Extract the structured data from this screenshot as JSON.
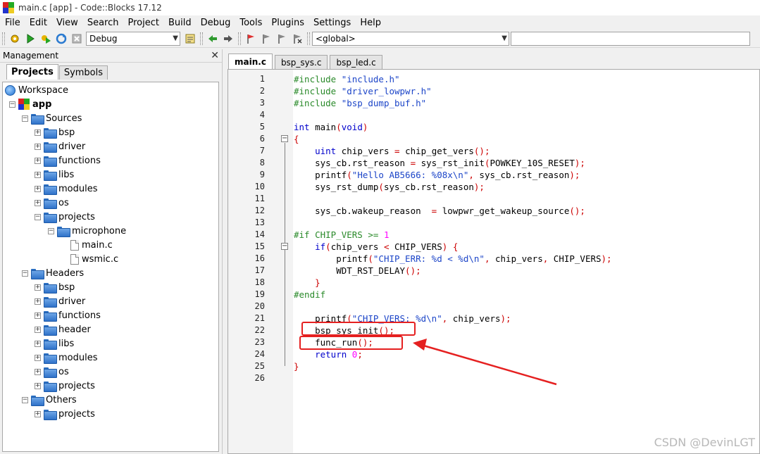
{
  "window": {
    "title": "main.c [app] - Code::Blocks 17.12"
  },
  "menu": [
    "File",
    "Edit",
    "View",
    "Search",
    "Project",
    "Build",
    "Debug",
    "Tools",
    "Plugins",
    "Settings",
    "Help"
  ],
  "toolbar": {
    "build_target": "Debug",
    "scope": "<global>",
    "function": ""
  },
  "management": {
    "title": "Management",
    "close": "✕",
    "tabs": [
      "Projects",
      "Symbols"
    ],
    "tree": [
      {
        "label": "Workspace",
        "level": 0,
        "kind": "workspace"
      },
      {
        "label": "app",
        "level": 1,
        "kind": "project",
        "expander": "−"
      },
      {
        "label": "Sources",
        "level": 2,
        "kind": "folder",
        "expander": "−"
      },
      {
        "label": "bsp",
        "level": 3,
        "kind": "folder",
        "expander": "+"
      },
      {
        "label": "driver",
        "level": 3,
        "kind": "folder",
        "expander": "+"
      },
      {
        "label": "functions",
        "level": 3,
        "kind": "folder",
        "expander": "+"
      },
      {
        "label": "libs",
        "level": 3,
        "kind": "folder",
        "expander": "+"
      },
      {
        "label": "modules",
        "level": 3,
        "kind": "folder",
        "expander": "+"
      },
      {
        "label": "os",
        "level": 3,
        "kind": "folder",
        "expander": "+"
      },
      {
        "label": "projects",
        "level": 3,
        "kind": "folder",
        "expander": "−"
      },
      {
        "label": "microphone",
        "level": 4,
        "kind": "folder",
        "expander": "−"
      },
      {
        "label": "main.c",
        "level": 5,
        "kind": "file"
      },
      {
        "label": "wsmic.c",
        "level": 5,
        "kind": "file"
      },
      {
        "label": "Headers",
        "level": 2,
        "kind": "folder",
        "expander": "−"
      },
      {
        "label": "bsp",
        "level": 3,
        "kind": "folder",
        "expander": "+"
      },
      {
        "label": "driver",
        "level": 3,
        "kind": "folder",
        "expander": "+"
      },
      {
        "label": "functions",
        "level": 3,
        "kind": "folder",
        "expander": "+"
      },
      {
        "label": "header",
        "level": 3,
        "kind": "folder",
        "expander": "+"
      },
      {
        "label": "libs",
        "level": 3,
        "kind": "folder",
        "expander": "+"
      },
      {
        "label": "modules",
        "level": 3,
        "kind": "folder",
        "expander": "+"
      },
      {
        "label": "os",
        "level": 3,
        "kind": "folder",
        "expander": "+"
      },
      {
        "label": "projects",
        "level": 3,
        "kind": "folder",
        "expander": "+"
      },
      {
        "label": "Others",
        "level": 2,
        "kind": "folder",
        "expander": "−"
      },
      {
        "label": "projects",
        "level": 3,
        "kind": "folder",
        "expander": "+"
      }
    ]
  },
  "editor": {
    "tabs": [
      "main.c",
      "bsp_sys.c",
      "bsp_led.c"
    ],
    "active_tab": 0,
    "lines": [
      [
        [
          "pp",
          "#include "
        ],
        [
          "str",
          "\"include.h\""
        ]
      ],
      [
        [
          "pp",
          "#include "
        ],
        [
          "str",
          "\"driver_lowpwr.h\""
        ]
      ],
      [
        [
          "pp",
          "#include "
        ],
        [
          "str",
          "\"bsp_dump_buf.h\""
        ]
      ],
      [],
      [
        [
          "kw",
          "int"
        ],
        [
          "",
          " main"
        ],
        [
          "op",
          "("
        ],
        [
          "kw",
          "void"
        ],
        [
          "op",
          ")"
        ]
      ],
      [
        [
          "op",
          "{"
        ]
      ],
      [
        [
          "",
          "    "
        ],
        [
          "kw",
          "uint"
        ],
        [
          "",
          " chip_vers "
        ],
        [
          "op",
          "="
        ],
        [
          "",
          " chip_get_vers"
        ],
        [
          "op",
          "();"
        ]
      ],
      [
        [
          "",
          "    sys_cb.rst_reason "
        ],
        [
          "op",
          "="
        ],
        [
          "",
          " sys_rst_init"
        ],
        [
          "op",
          "("
        ],
        [
          "",
          "POWKEY_10S_RESET"
        ],
        [
          "op",
          ");"
        ]
      ],
      [
        [
          "",
          "    printf"
        ],
        [
          "op",
          "("
        ],
        [
          "str",
          "\"Hello AB5666: %08x\\n\""
        ],
        [
          "op",
          ","
        ],
        [
          "",
          " sys_cb.rst_reason"
        ],
        [
          "op",
          ");"
        ]
      ],
      [
        [
          "",
          "    sys_rst_dump"
        ],
        [
          "op",
          "("
        ],
        [
          "",
          "sys_cb.rst_reason"
        ],
        [
          "op",
          ");"
        ]
      ],
      [],
      [
        [
          "",
          "    sys_cb.wakeup_reason  "
        ],
        [
          "op",
          "="
        ],
        [
          "",
          " lowpwr_get_wakeup_source"
        ],
        [
          "op",
          "();"
        ]
      ],
      [],
      [
        [
          "pp",
          "#if CHIP_VERS >= "
        ],
        [
          "num",
          "1"
        ]
      ],
      [
        [
          "",
          "    "
        ],
        [
          "kw",
          "if"
        ],
        [
          "op",
          "("
        ],
        [
          "",
          "chip_vers "
        ],
        [
          "op",
          "<"
        ],
        [
          "",
          " CHIP_VERS"
        ],
        [
          "op",
          ")"
        ],
        [
          "",
          " "
        ],
        [
          "op",
          "{"
        ]
      ],
      [
        [
          "",
          "        printf"
        ],
        [
          "op",
          "("
        ],
        [
          "str",
          "\"CHIP_ERR: %d < %d\\n\""
        ],
        [
          "op",
          ","
        ],
        [
          "",
          " chip_vers"
        ],
        [
          "op",
          ","
        ],
        [
          "",
          " CHIP_VERS"
        ],
        [
          "op",
          ");"
        ]
      ],
      [
        [
          "",
          "        WDT_RST_DELAY"
        ],
        [
          "op",
          "();"
        ]
      ],
      [
        [
          "",
          "    "
        ],
        [
          "op",
          "}"
        ]
      ],
      [
        [
          "pp",
          "#endif"
        ]
      ],
      [],
      [
        [
          "",
          "    printf"
        ],
        [
          "op",
          "("
        ],
        [
          "str",
          "\"CHIP_VERS: %d\\n\""
        ],
        [
          "op",
          ","
        ],
        [
          "",
          " chip_vers"
        ],
        [
          "op",
          ");"
        ]
      ],
      [
        [
          "",
          "    bsp_sys_init"
        ],
        [
          "op",
          "();"
        ]
      ],
      [
        [
          "",
          "    func_run"
        ],
        [
          "op",
          "();"
        ]
      ],
      [
        [
          "",
          "    "
        ],
        [
          "kw",
          "return"
        ],
        [
          "",
          " "
        ],
        [
          "num",
          "0"
        ],
        [
          "op",
          ";"
        ]
      ],
      [
        [
          "op",
          "}"
        ]
      ],
      []
    ]
  },
  "watermark": "CSDN @DevinLGT",
  "colors": {
    "preprocessor": "#2a8a2a",
    "string": "#1c45c8",
    "keyword": "#0000cc",
    "number": "#ff00ff",
    "operator": "#cc0000",
    "annotation": "#e52020"
  }
}
